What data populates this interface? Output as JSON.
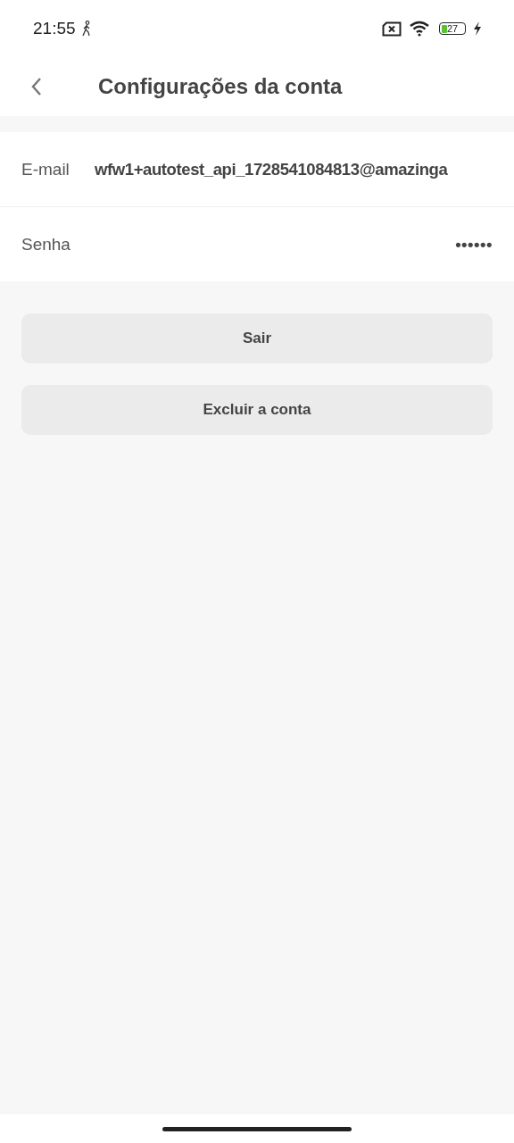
{
  "status_bar": {
    "time": "21:55",
    "battery": "27"
  },
  "header": {
    "title": "Configurações da conta"
  },
  "fields": [
    {
      "label": "E-mail",
      "value": "wfw1+autotest_api_1728541084813@amazinga",
      "kind": "text"
    },
    {
      "label": "Senha",
      "value": "••••••",
      "kind": "password"
    }
  ],
  "buttons": [
    "Sair",
    "Excluir a conta"
  ]
}
